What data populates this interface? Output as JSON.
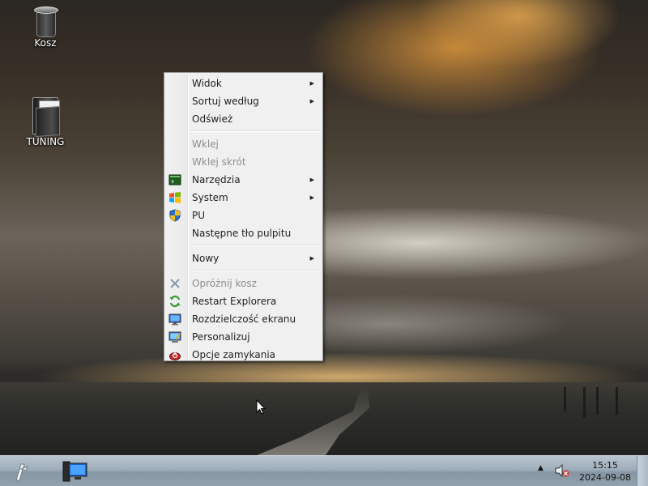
{
  "desktop": {
    "icons": [
      {
        "label": "Kosz",
        "icon": "recycle-bin-icon"
      },
      {
        "label": "TUNING",
        "icon": "folder-icon"
      }
    ]
  },
  "context_menu": {
    "items": [
      {
        "label": "Widok",
        "submenu": true,
        "enabled": true
      },
      {
        "label": "Sortuj według",
        "submenu": true,
        "enabled": true
      },
      {
        "label": "Odśwież",
        "submenu": false,
        "enabled": true
      },
      {
        "label": "Wklej",
        "submenu": false,
        "enabled": false
      },
      {
        "label": "Wklej skrót",
        "submenu": false,
        "enabled": false
      },
      {
        "label": "Narzędzia",
        "submenu": true,
        "enabled": true,
        "icon": "console-icon"
      },
      {
        "label": "System",
        "submenu": true,
        "enabled": true,
        "icon": "windows-logo-icon"
      },
      {
        "label": "PU",
        "submenu": false,
        "enabled": true,
        "icon": "uac-shield-icon"
      },
      {
        "label": "Następne tło pulpitu",
        "submenu": false,
        "enabled": true
      },
      {
        "label": "Nowy",
        "submenu": true,
        "enabled": true
      },
      {
        "label": "Opróżnij kosz",
        "submenu": false,
        "enabled": false,
        "icon": "empty-bin-icon"
      },
      {
        "label": "Restart Explorera",
        "submenu": false,
        "enabled": true,
        "icon": "restart-arrows-icon"
      },
      {
        "label": "Rozdzielczość ekranu",
        "submenu": false,
        "enabled": true,
        "icon": "monitor-icon"
      },
      {
        "label": "Personalizuj",
        "submenu": false,
        "enabled": true,
        "icon": "personalize-monitor-icon"
      },
      {
        "label": "Opcje zamykania",
        "submenu": false,
        "enabled": true,
        "icon": "power-options-icon"
      }
    ]
  },
  "taskbar": {
    "clock_time": "15:15",
    "clock_date": "2024-09-08",
    "tray_icons": [
      "show-hidden-icons-arrow-icon",
      "volume-muted-icon"
    ]
  },
  "colors": {
    "menu_background": "#f0f0f0",
    "menu_disabled_text": "#8d8d8d",
    "taskbar": "#9faebb"
  }
}
